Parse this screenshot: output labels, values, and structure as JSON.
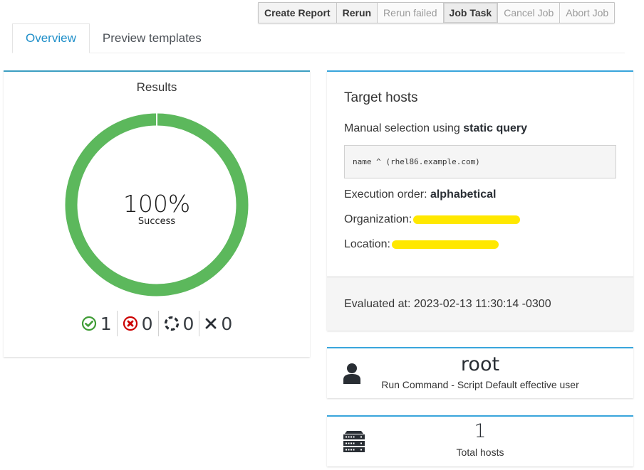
{
  "toolbar": {
    "buttons": [
      {
        "label": "Create Report",
        "state": "enabled"
      },
      {
        "label": "Rerun",
        "state": "enabled"
      },
      {
        "label": "Rerun failed",
        "state": "disabled"
      },
      {
        "label": "Job Task",
        "state": "active"
      },
      {
        "label": "Cancel Job",
        "state": "disabled"
      },
      {
        "label": "Abort Job",
        "state": "disabled"
      }
    ]
  },
  "tabs": [
    {
      "label": "Overview",
      "active": true
    },
    {
      "label": "Preview templates",
      "active": false
    }
  ],
  "results": {
    "title": "Results",
    "percent_label": "100%",
    "status_label": "Success",
    "success_fraction": 1.0,
    "colors": {
      "success": "#5cb85c",
      "failed": "#cc0000",
      "accent": "#39a5dc"
    },
    "counts": [
      {
        "icon": "check-circle-icon",
        "value": "1"
      },
      {
        "icon": "error-circle-icon",
        "value": "0"
      },
      {
        "icon": "pending-spinner-icon",
        "value": "0"
      },
      {
        "icon": "cancelled-x-icon",
        "value": "0"
      }
    ]
  },
  "target_hosts": {
    "title": "Target hosts",
    "selection_prefix": "Manual selection using ",
    "selection_type": "static query",
    "query": "name ^ (rhel86.example.com)",
    "execution_order_label": "Execution order: ",
    "execution_order_value": "alphabetical",
    "organization_label": "Organization:",
    "location_label": "Location:",
    "evaluated_at": "Evaluated at: 2023-02-13 11:30:14 -0300"
  },
  "effective_user": {
    "value": "root",
    "description": "Run Command - Script Default effective user",
    "icon": "user-icon"
  },
  "total_hosts": {
    "value": "1",
    "label": "Total hosts",
    "icon": "server-icon"
  }
}
